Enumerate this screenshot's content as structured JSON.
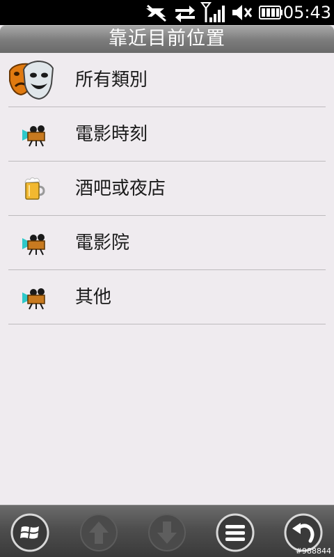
{
  "status_bar": {
    "time": "05:43",
    "icons": [
      "data-off-icon",
      "data-transfer-icon",
      "signal-strength-icon",
      "speaker-mute-icon",
      "battery-icon"
    ]
  },
  "header": {
    "title": "靠近目前位置"
  },
  "categories": [
    {
      "label": "所有類別",
      "icon": "theater-masks-icon"
    },
    {
      "label": "電影時刻",
      "icon": "movie-camera-icon"
    },
    {
      "label": "酒吧或夜店",
      "icon": "beer-mug-icon"
    },
    {
      "label": "電影院",
      "icon": "movie-camera-icon"
    },
    {
      "label": "其他",
      "icon": "movie-camera-icon"
    }
  ],
  "toolbar": {
    "buttons": [
      {
        "icon": "windows-start-icon",
        "enabled": true
      },
      {
        "icon": "arrow-up-icon",
        "enabled": false
      },
      {
        "icon": "arrow-down-icon",
        "enabled": false
      },
      {
        "icon": "menu-icon",
        "enabled": true
      },
      {
        "icon": "back-icon",
        "enabled": true
      }
    ]
  },
  "watermark": "#988844"
}
